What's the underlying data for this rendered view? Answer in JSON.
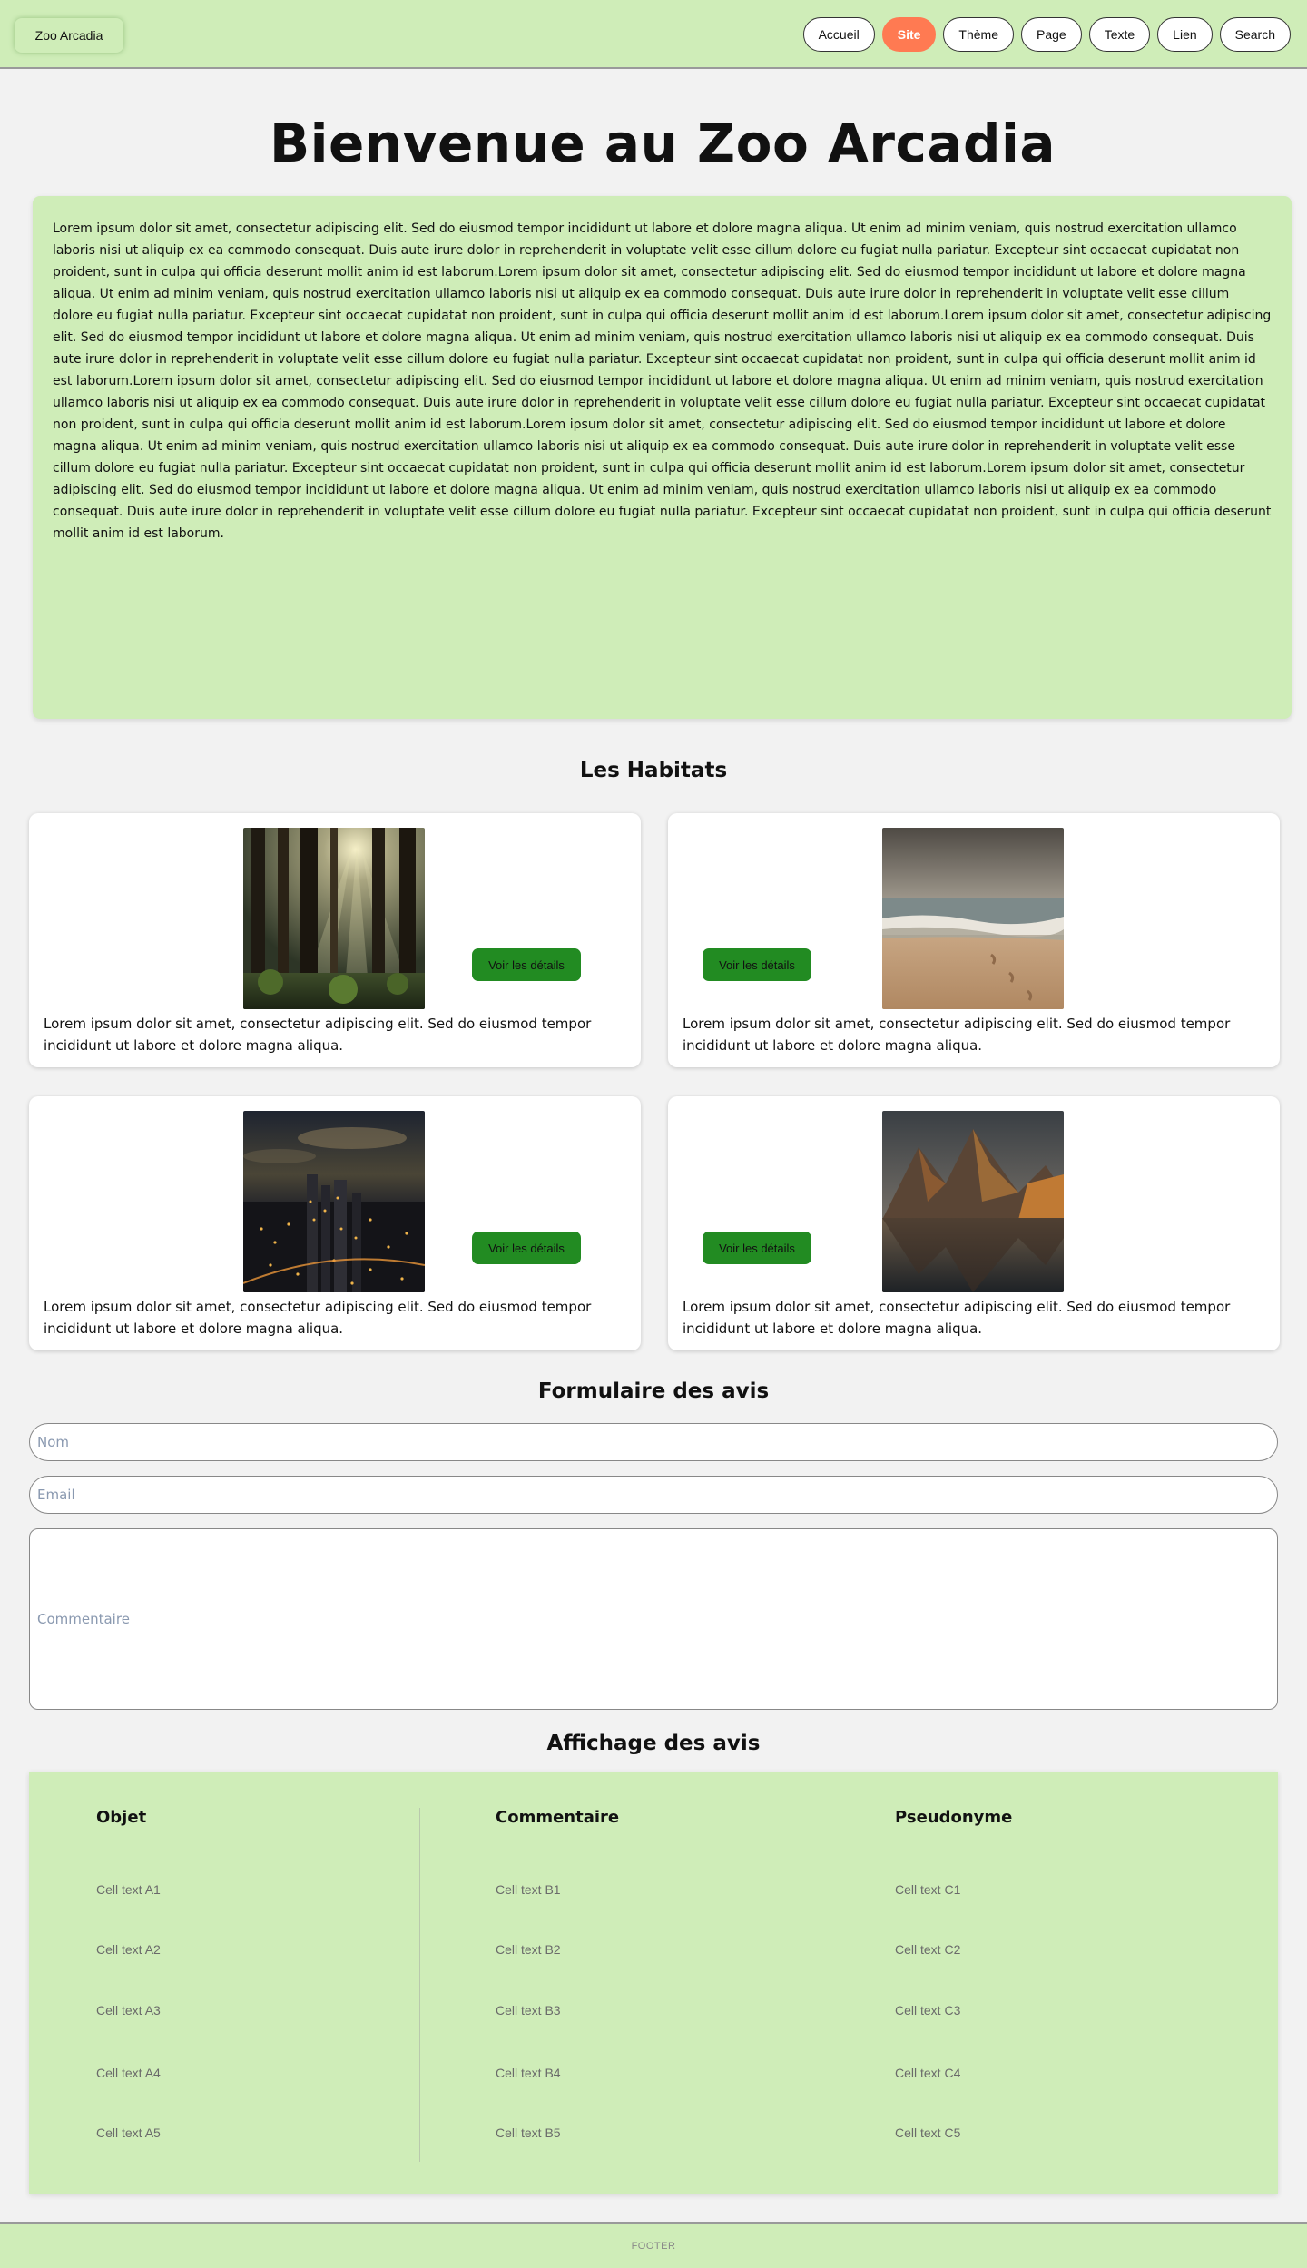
{
  "header": {
    "brand": "Zoo Arcadia",
    "nav": [
      "Accueil",
      "Site",
      "Thème",
      "Page",
      "Texte",
      "Lien",
      "Search"
    ],
    "active_nav": "Site"
  },
  "main": {
    "title": "Bienvenue au Zoo Arcadia",
    "intro_text": "Lorem ipsum dolor sit amet, consectetur adipiscing elit. Sed do eiusmod tempor incididunt ut labore et dolore magna aliqua. Ut enim ad minim veniam, quis nostrud exercitation ullamco laboris nisi ut aliquip ex ea commodo consequat. Duis aute irure dolor in reprehenderit in voluptate velit esse cillum dolore eu fugiat nulla pariatur. Excepteur sint occaecat cupidatat non proident, sunt in culpa qui officia deserunt mollit anim id est laborum.Lorem ipsum dolor sit amet, consectetur adipiscing elit. Sed do eiusmod tempor incididunt ut labore et dolore magna aliqua. Ut enim ad minim veniam, quis nostrud exercitation ullamco laboris nisi ut aliquip ex ea commodo consequat. Duis aute irure dolor in reprehenderit in voluptate velit esse cillum dolore eu fugiat nulla pariatur. Excepteur sint occaecat cupidatat non proident, sunt in culpa qui officia deserunt mollit anim id est laborum.Lorem ipsum dolor sit amet, consectetur adipiscing elit. Sed do eiusmod tempor incididunt ut labore et dolore magna aliqua. Ut enim ad minim veniam, quis nostrud exercitation ullamco laboris nisi ut aliquip ex ea commodo consequat. Duis aute irure dolor in reprehenderit in voluptate velit esse cillum dolore eu fugiat nulla pariatur. Excepteur sint occaecat cupidatat non proident, sunt in culpa qui officia deserunt mollit anim id est laborum.Lorem ipsum dolor sit amet, consectetur adipiscing elit. Sed do eiusmod tempor incididunt ut labore et dolore magna aliqua. Ut enim ad minim veniam, quis nostrud exercitation ullamco laboris nisi ut aliquip ex ea commodo consequat. Duis aute irure dolor in reprehenderit in voluptate velit esse cillum dolore eu fugiat nulla pariatur. Excepteur sint occaecat cupidatat non proident, sunt in culpa qui officia deserunt mollit anim id est laborum.Lorem ipsum dolor sit amet, consectetur adipiscing elit. Sed do eiusmod tempor incididunt ut labore et dolore magna aliqua. Ut enim ad minim veniam, quis nostrud exercitation ullamco laboris nisi ut aliquip ex ea commodo consequat. Duis aute irure dolor in reprehenderit in voluptate velit esse cillum dolore eu fugiat nulla pariatur. Excepteur sint occaecat cupidatat non proident, sunt in culpa qui officia deserunt mollit anim id est laborum.Lorem ipsum dolor sit amet, consectetur adipiscing elit. Sed do eiusmod tempor incididunt ut labore et dolore magna aliqua. Ut enim ad minim veniam, quis nostrud exercitation ullamco laboris nisi ut aliquip ex ea commodo consequat. Duis aute irure dolor in reprehenderit in voluptate velit esse cillum dolore eu fugiat nulla pariatur. Excepteur sint occaecat cupidatat non proident, sunt in culpa qui officia deserunt mollit anim id est laborum."
  },
  "habitats": {
    "title": "Les Habitats",
    "cards": [
      {
        "image": "forest",
        "button": "Voir les détails",
        "text": "Lorem ipsum dolor sit amet, consectetur adipiscing elit. Sed do eiusmod tempor incididunt ut labore et dolore magna aliqua."
      },
      {
        "image": "beach",
        "button": "Voir les détails",
        "text": "Lorem ipsum dolor sit amet, consectetur adipiscing elit. Sed do eiusmod tempor incididunt ut labore et dolore magna aliqua."
      },
      {
        "image": "city-night",
        "button": "Voir les détails",
        "text": "Lorem ipsum dolor sit amet, consectetur adipiscing elit. Sed do eiusmod tempor incididunt ut labore et dolore magna aliqua."
      },
      {
        "image": "mountain-lake",
        "button": "Voir les détails",
        "text": "Lorem ipsum dolor sit amet, consectetur adipiscing elit. Sed do eiusmod tempor incididunt ut labore et dolore magna aliqua."
      }
    ]
  },
  "form": {
    "title": "Formulaire des avis",
    "name_placeholder": "Nom",
    "email_placeholder": "Email",
    "comment_placeholder": "Commentaire"
  },
  "reviews": {
    "title": "Affichage des avis",
    "columns": [
      "Objet",
      "Commentaire",
      "Pseudonyme"
    ],
    "rows": [
      [
        "Cell text A1",
        "Cell text B1",
        "Cell text C1"
      ],
      [
        "Cell text A2",
        "Cell text B2",
        "Cell text C2"
      ],
      [
        "Cell text A3",
        "Cell text B3",
        "Cell text C3"
      ],
      [
        "Cell text A4",
        "Cell text B4",
        "Cell text C4"
      ],
      [
        "Cell text A5",
        "Cell text B5",
        "Cell text C5"
      ]
    ]
  },
  "footer": {
    "text": "FOOTER"
  },
  "colors": {
    "header_bg": "#cfedb8",
    "accent": "#ff7a52",
    "button_green": "#228b22",
    "page_bg": "#f2f2f2"
  }
}
